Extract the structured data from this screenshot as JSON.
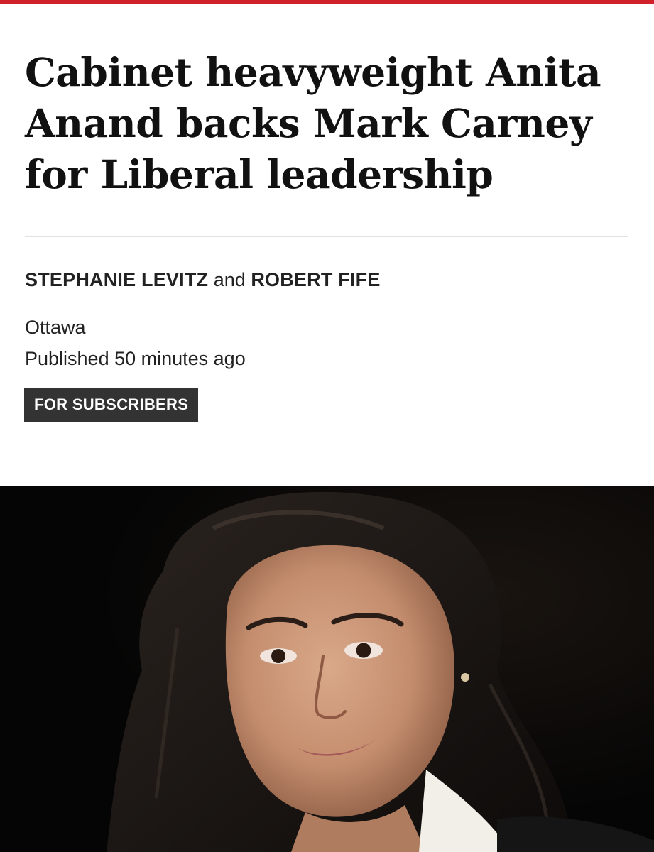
{
  "colors": {
    "accent": "#d0202a",
    "badge_bg": "#333333",
    "badge_text": "#ffffff",
    "photo_bg": "#060606"
  },
  "article": {
    "headline": "Cabinet heavyweight Anita Anand backs Mark Carney for Liberal leadership",
    "byline": {
      "author_1": "STEPHANIE LEVITZ",
      "joiner": "and",
      "author_2": "ROBERT FIFE"
    },
    "dateline": "Ottawa",
    "published": "Published 50 minutes ago",
    "badge": "FOR SUBSCRIBERS"
  }
}
